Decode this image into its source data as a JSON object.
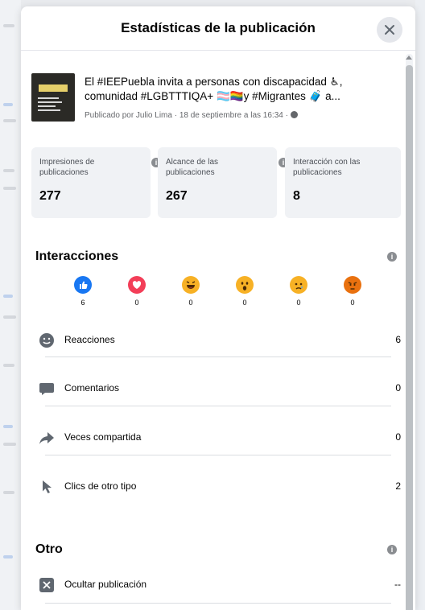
{
  "dialog": {
    "title": "Estadísticas de la publicación"
  },
  "post": {
    "line1": "El #IEEPuebla invita a personas con discapacidad ♿,",
    "line2": "comunidad #LGBTTTIQA+ 🏳️‍⚧️🏳️‍🌈y #Migrantes 🧳 a...",
    "meta": "Publicado por Julio Lima · 18 de septiembre a las 16:34 ·"
  },
  "stats": [
    {
      "label": "Impresiones de publicaciones",
      "value": "277"
    },
    {
      "label": "Alcance de las publicaciones",
      "value": "267"
    },
    {
      "label": "Interacción con las publicaciones",
      "value": "8"
    }
  ],
  "interactions": {
    "title": "Interacciones",
    "reactions": [
      {
        "name": "like",
        "count": "6",
        "color": "#1877f2"
      },
      {
        "name": "love",
        "count": "0",
        "color": "#f33e58"
      },
      {
        "name": "haha",
        "count": "0",
        "color": "#f7b125"
      },
      {
        "name": "wow",
        "count": "0",
        "color": "#f7b125"
      },
      {
        "name": "sad",
        "count": "0",
        "color": "#f7b125"
      },
      {
        "name": "angry",
        "count": "0",
        "color": "#e9710f"
      }
    ],
    "rows": [
      {
        "label": "Reacciones",
        "value": "6",
        "icon": "smiley-icon"
      },
      {
        "label": "Comentarios",
        "value": "0",
        "icon": "comment-icon"
      },
      {
        "label": "Veces compartida",
        "value": "0",
        "icon": "share-icon"
      },
      {
        "label": "Clics de otro tipo",
        "value": "2",
        "icon": "cursor-icon"
      }
    ]
  },
  "other": {
    "title": "Otro",
    "rows": [
      {
        "label": "Ocultar publicación",
        "value": "--",
        "icon": "hide-icon"
      }
    ]
  }
}
